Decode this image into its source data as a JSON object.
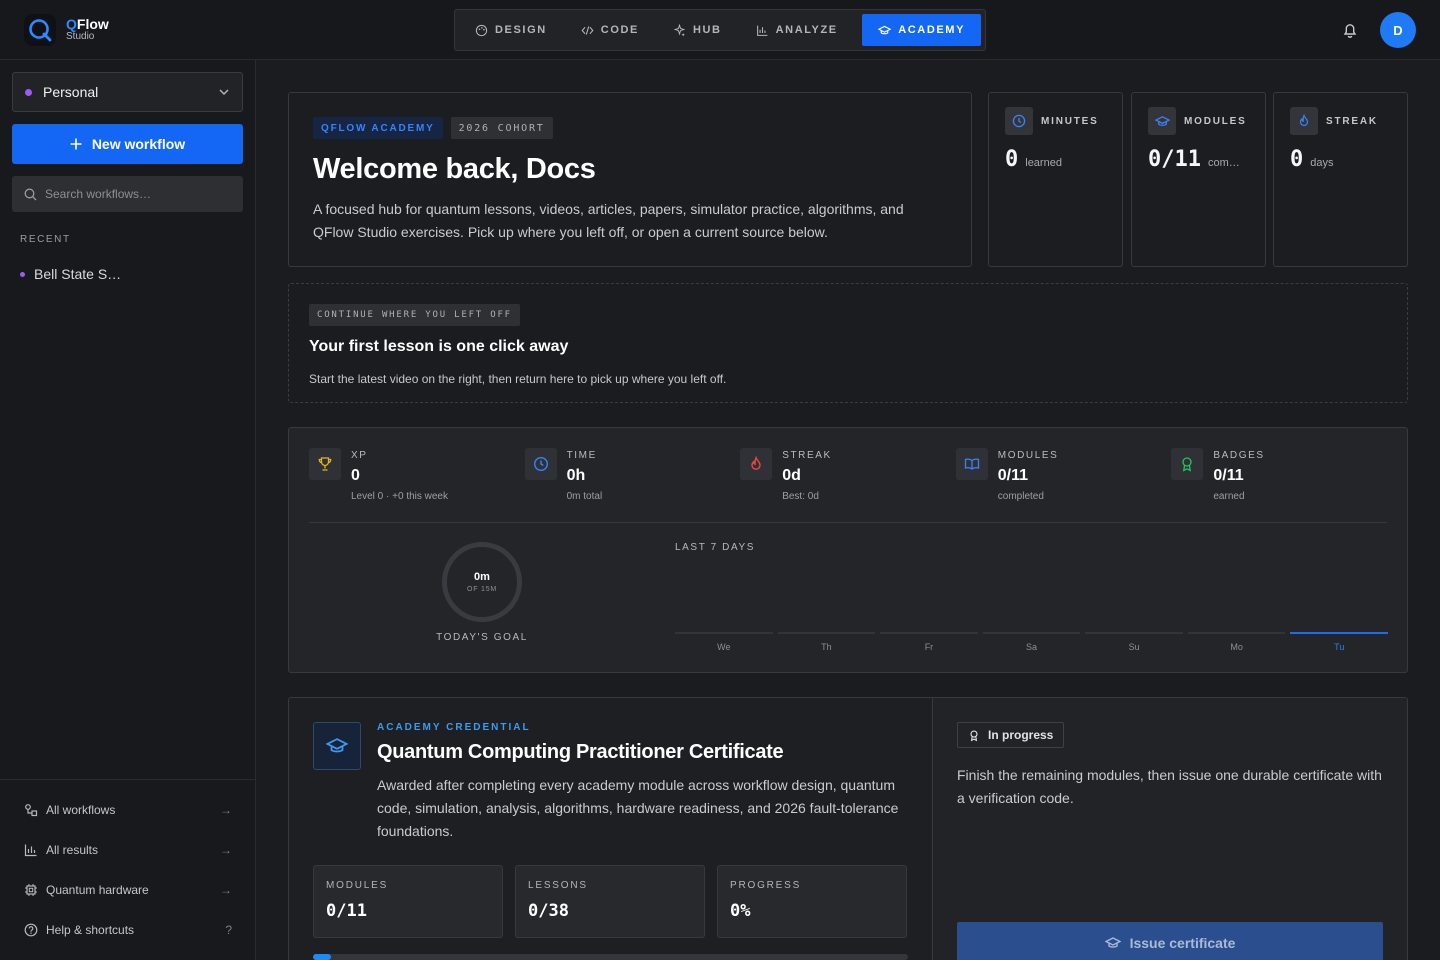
{
  "app": {
    "name_q": "Q",
    "name_rest": "Flow",
    "subtitle": "Studio"
  },
  "nav": [
    {
      "label": "DESIGN",
      "icon": "palette-icon"
    },
    {
      "label": "CODE",
      "icon": "code-icon"
    },
    {
      "label": "HUB",
      "icon": "sparkles-icon"
    },
    {
      "label": "ANALYZE",
      "icon": "bar-chart-icon"
    },
    {
      "label": "ACADEMY",
      "icon": "graduation-cap-icon",
      "active": true
    }
  ],
  "user": {
    "initial": "D"
  },
  "sidebar": {
    "workspace": "Personal",
    "new_workflow": "New workflow",
    "search_placeholder": "Search workflows…",
    "recent_label": "RECENT",
    "recent": [
      "Bell State S…"
    ],
    "links": [
      {
        "label": "All workflows",
        "icon": "workflow-icon",
        "hint": "→"
      },
      {
        "label": "All results",
        "icon": "bar-chart-icon",
        "hint": "→"
      },
      {
        "label": "Quantum hardware",
        "icon": "chip-icon",
        "hint": "→"
      },
      {
        "label": "Help & shortcuts",
        "icon": "help-icon",
        "hint": "?"
      }
    ]
  },
  "hero": {
    "tag1": "QFLOW ACADEMY",
    "tag2": "2026 COHORT",
    "title": "Welcome back, Docs",
    "desc": "A focused hub for quantum lessons, videos, articles, papers, simulator practice, algorithms, and QFlow Studio exercises. Pick up where you left off, or open a current source below."
  },
  "stats": [
    {
      "label": "MINUTES",
      "value": "0",
      "unit": "learned",
      "icon": "clock-icon"
    },
    {
      "label": "MODULES",
      "value": "0/11",
      "unit": "com…",
      "icon": "graduation-cap-icon"
    },
    {
      "label": "STREAK",
      "value": "0",
      "unit": "days",
      "icon": "flame-icon"
    }
  ],
  "continue": {
    "tag": "CONTINUE WHERE YOU LEFT OFF",
    "title": "Your first lesson is one click away",
    "desc": "Start the latest video on the right, then return here to pick up where you left off."
  },
  "metrics": [
    {
      "label": "XP",
      "value": "0",
      "sub": "Level 0 · +0 this week",
      "icon": "trophy-icon",
      "color": "#e5b424"
    },
    {
      "label": "TIME",
      "value": "0h",
      "sub": "0m total",
      "icon": "clock-icon",
      "color": "#3b82f6"
    },
    {
      "label": "STREAK",
      "value": "0d",
      "sub": "Best: 0d",
      "icon": "flame-icon",
      "color": "#ef4444"
    },
    {
      "label": "MODULES",
      "value": "0/11",
      "sub": "completed",
      "icon": "book-icon",
      "color": "#3b82f6"
    },
    {
      "label": "BADGES",
      "value": "0/11",
      "sub": "earned",
      "icon": "award-icon",
      "color": "#22c55e"
    }
  ],
  "goal": {
    "value": "0m",
    "of": "OF 15M",
    "label": "TODAY'S GOAL",
    "progress": 0
  },
  "week": {
    "label": "LAST 7 DAYS",
    "days": [
      "We",
      "Th",
      "Fr",
      "Sa",
      "Su",
      "Mo",
      "Tu"
    ],
    "minutes": [
      0,
      0,
      0,
      0,
      0,
      0,
      0
    ],
    "today_index": 6
  },
  "cert": {
    "kicker": "ACADEMY CREDENTIAL",
    "title": "Quantum Computing Practitioner Certificate",
    "desc": "Awarded after completing every academy module across workflow design, quantum code, simulation, analysis, algorithms, hardware readiness, and 2026 fault-tolerance foundations.",
    "stats": [
      {
        "label": "MODULES",
        "value": "0/11"
      },
      {
        "label": "LESSONS",
        "value": "0/38"
      },
      {
        "label": "PROGRESS",
        "value": "0%"
      }
    ],
    "progress": 0,
    "status": "In progress",
    "status_desc": "Finish the remaining modules, then issue one durable certificate with a verification code.",
    "issue_label": "Issue certificate"
  },
  "colors": {
    "accent": "#1466f5",
    "purple_dot": "#9b5cf6"
  }
}
